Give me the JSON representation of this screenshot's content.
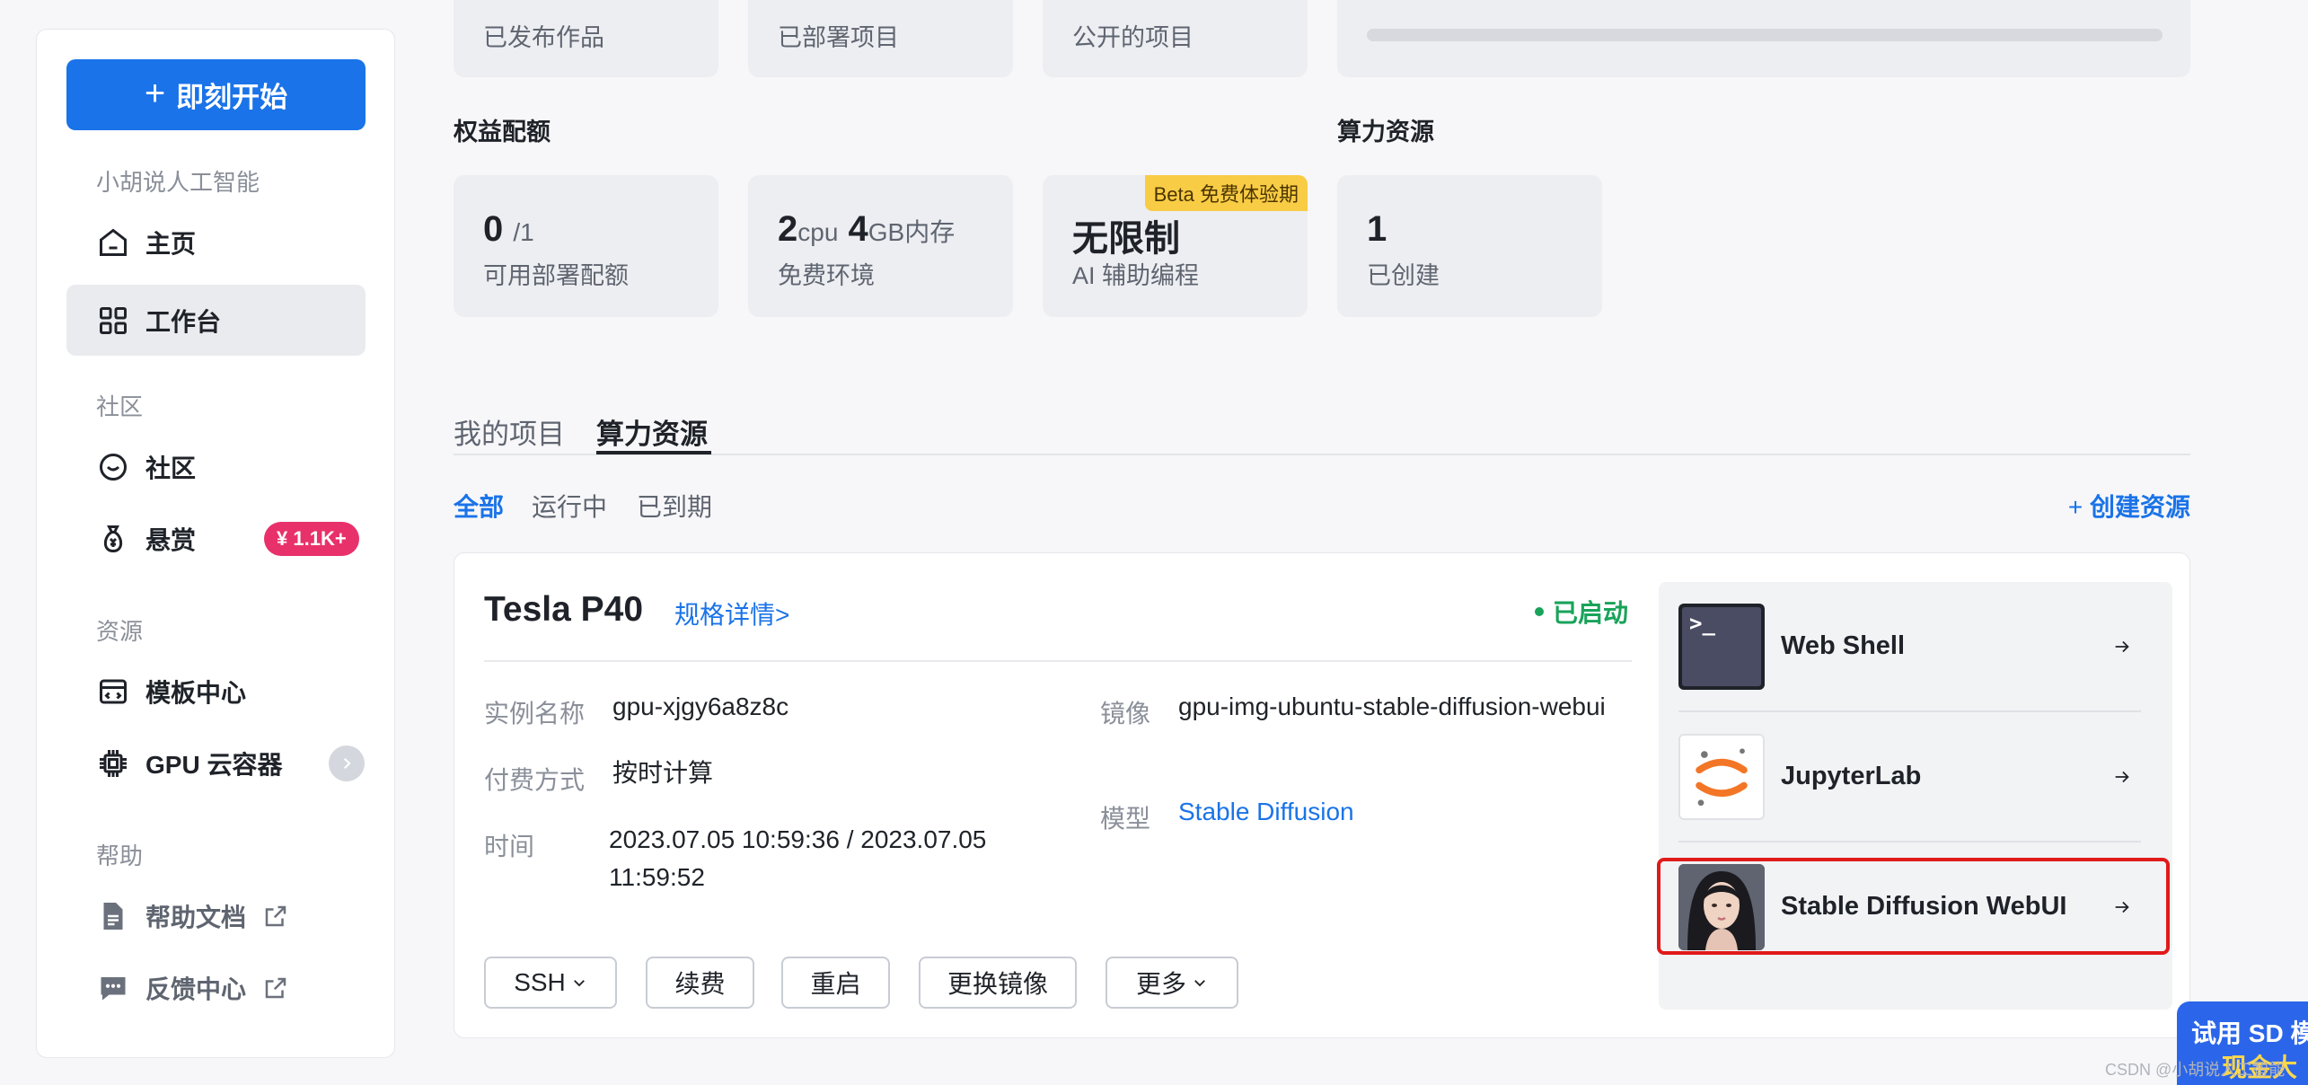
{
  "sidebar": {
    "start_button": "即刻开始",
    "team_name": "小胡说人工智能",
    "items": {
      "home": "主页",
      "workbench": "工作台",
      "community_section": "社区",
      "community": "社区",
      "bounty": "悬赏",
      "bounty_badge": "¥ 1.1K+",
      "resources_section": "资源",
      "template_center": "模板中心",
      "gpu_container": "GPU 云容器",
      "help_section": "帮助",
      "help_docs": "帮助文档",
      "feedback": "反馈中心"
    }
  },
  "top_cards": {
    "published_label": "已发布作品",
    "deployed_label": "已部署项目",
    "public_label": "公开的项目"
  },
  "quota": {
    "title": "权益配额",
    "deploy_value": "0",
    "deploy_unit": "/1",
    "deploy_label": "可用部署配额",
    "env_cpu": "2",
    "env_cpu_unit": "cpu",
    "env_mem": "4",
    "env_mem_unit": "GB内存",
    "env_label": "免费环境",
    "ai_value": "无限制",
    "ai_label": "AI 辅助编程",
    "ai_badge": "Beta 免费体验期"
  },
  "compute": {
    "title": "算力资源",
    "created_value": "1",
    "created_label": "已创建"
  },
  "tabs": [
    "我的项目",
    "算力资源"
  ],
  "filters": [
    "全部",
    "运行中",
    "已到期"
  ],
  "create_resource": "创建资源",
  "resource": {
    "name": "Tesla P40",
    "spec_link": "规格详情>",
    "status": "已启动",
    "instance_label": "实例名称",
    "instance_value": "gpu-xjgy6a8z8c",
    "billing_label": "付费方式",
    "billing_value": "按时计算",
    "time_label": "时间",
    "time_value": "2023.07.05 10:59:36 / 2023.07.05 11:59:52",
    "image_label": "镜像",
    "image_value": "gpu-img-ubuntu-stable-diffusion-webui",
    "model_label": "模型",
    "model_value": "Stable Diffusion",
    "buttons": {
      "ssh": "SSH",
      "renew": "续费",
      "restart": "重启",
      "change_image": "更换镜像",
      "more": "更多"
    },
    "apps": [
      "Web Shell",
      "JupyterLab",
      "Stable Diffusion WebUI"
    ]
  },
  "promo": {
    "line1": "试用 SD 模",
    "line2": "现金大"
  },
  "watermark": "CSDN @小胡说人工智能",
  "colors": {
    "accent": "#1a73e8",
    "success": "#19a35a",
    "badge": "#e8316a",
    "highlight": "#e01a1a"
  }
}
